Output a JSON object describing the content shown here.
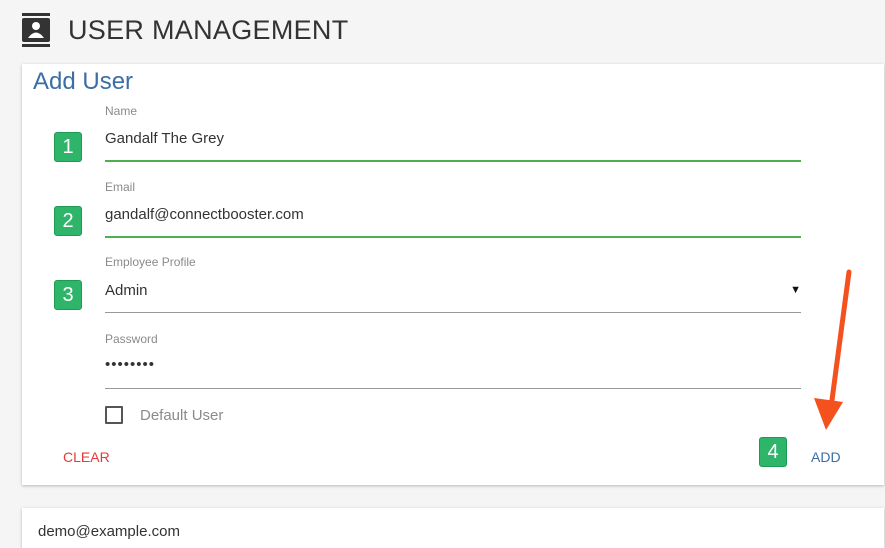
{
  "header": {
    "title": "USER MANAGEMENT",
    "icon": "contact-book-icon"
  },
  "form": {
    "title": "Add User",
    "name": {
      "label": "Name",
      "value": "Gandalf The Grey",
      "step": "1"
    },
    "email": {
      "label": "Email",
      "value": "gandalf@connectbooster.com",
      "step": "2"
    },
    "profile": {
      "label": "Employee Profile",
      "value": "Admin",
      "step": "3",
      "caret": "▼"
    },
    "password": {
      "label": "Password",
      "value": "••••••••"
    },
    "default_user": {
      "label": "Default User",
      "checked": false
    },
    "clear_label": "CLEAR",
    "add_label": "ADD",
    "add_step": "4"
  },
  "users": [
    {
      "email": "demo@example.com"
    }
  ],
  "colors": {
    "accent": "#3a6ea5",
    "focus": "#4caf50",
    "badge": "#2fb56a",
    "danger": "#e53935",
    "arrow": "#f4511e"
  }
}
